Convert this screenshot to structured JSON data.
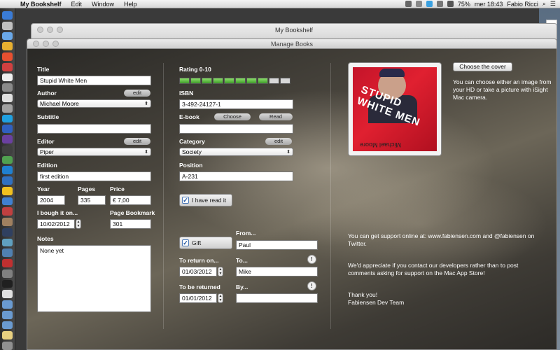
{
  "menubar": {
    "app": "My Bookshelf",
    "menus": [
      "Edit",
      "Window",
      "Help"
    ],
    "battery": "75%",
    "datetime": "mer 18:43",
    "user": "Fabio Ricci"
  },
  "back_window": {
    "title": "My Bookshelf"
  },
  "window": {
    "title": "Manage Books"
  },
  "form": {
    "title_label": "Title",
    "title_value": "Stupid White Men",
    "author_label": "Author",
    "author_value": "Michael Moore",
    "edit_label": "edit",
    "subtitle_label": "Subtitle",
    "subtitle_value": "",
    "editor_label": "Editor",
    "editor_value": "Piper",
    "edition_label": "Edition",
    "edition_value": "first edition",
    "year_label": "Year",
    "year_value": "2004",
    "pages_label": "Pages",
    "pages_value": "335",
    "price_label": "Price",
    "price_value": "€ 7,00",
    "bought_label": "I bough it on...",
    "bought_value": "10/02/2012",
    "bookmark_label": "Page Bookmark",
    "bookmark_value": "301",
    "notes_label": "Notes",
    "notes_value": "None yet",
    "rating_label": "Rating 0-10",
    "rating_value": 8,
    "rating_max": 10,
    "isbn_label": "ISBN",
    "isbn_value": "3-492-24127-1",
    "ebook_label": "E-book",
    "ebook_choose": "Choose",
    "ebook_read": "Read",
    "ebook_value": "",
    "category_label": "Category",
    "category_value": "Society",
    "position_label": "Position",
    "position_value": "A-231",
    "read_label": "I have read it",
    "gift_label": "Gift",
    "from_label": "From...",
    "from_value": "Paul",
    "return_on_label": "To return on...",
    "return_on_value": "01/03/2012",
    "to_label": "To...",
    "to_value": "Mike",
    "be_returned_label": "To be returned",
    "be_returned_value": "01/01/2012",
    "by_label": "By...",
    "by_value": ""
  },
  "cover": {
    "choose_button": "Choose the cover",
    "hint": "You can choose either an image from your HD or take a picture with iSight Mac camera.",
    "cover_title": "STUPID WHITE MEN",
    "cover_author": "Michael Moore"
  },
  "support": {
    "line1": "You can get support online at: www.fabiensen.com and @fabiensen on Twitter.",
    "line2": "We'd appreciate if you contact our developers rather than to post comments asking for support on the Mac App Store!",
    "thanks": "Thank you!",
    "team": "Fabiensen Dev Team"
  },
  "colors": {
    "rating_on": "#5cc23e",
    "rating_off": "#d8d8d8"
  }
}
